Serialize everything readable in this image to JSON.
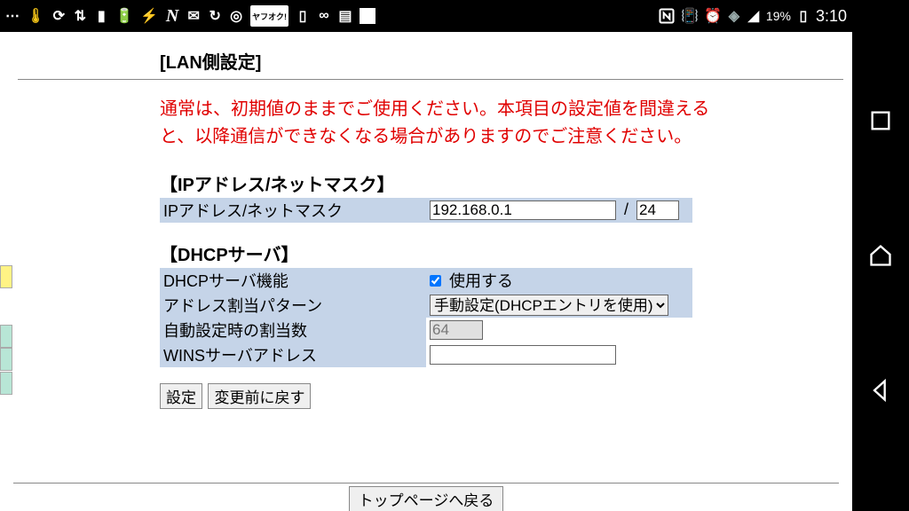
{
  "status": {
    "battery_pct": "19%",
    "clock": "3:10",
    "n_label": "N"
  },
  "page": {
    "title": "[LAN側設定]",
    "warning": "通常は、初期値のままでご使用ください。本項目の設定値を間違えると、以降通信ができなくなる場合がありますのでご注意ください。"
  },
  "ip_section": {
    "header": "【IPアドレス/ネットマスク】",
    "label": "IPアドレス/ネットマスク",
    "ip_value": "192.168.0.1",
    "mask_value": "24",
    "slash": "/"
  },
  "dhcp_section": {
    "header": "【DHCPサーバ】",
    "func_label": "DHCPサーバ機能",
    "func_use_label": "使用する",
    "pattern_label": "アドレス割当パターン",
    "pattern_value": "手動設定(DHCPエントリを使用)",
    "auto_label": "自動設定時の割当数",
    "auto_value": "64",
    "wins_label": "WINSサーバアドレス",
    "wins_value": ""
  },
  "buttons": {
    "apply": "設定",
    "revert": "変更前に戻す",
    "top": "トップページへ戻る"
  }
}
